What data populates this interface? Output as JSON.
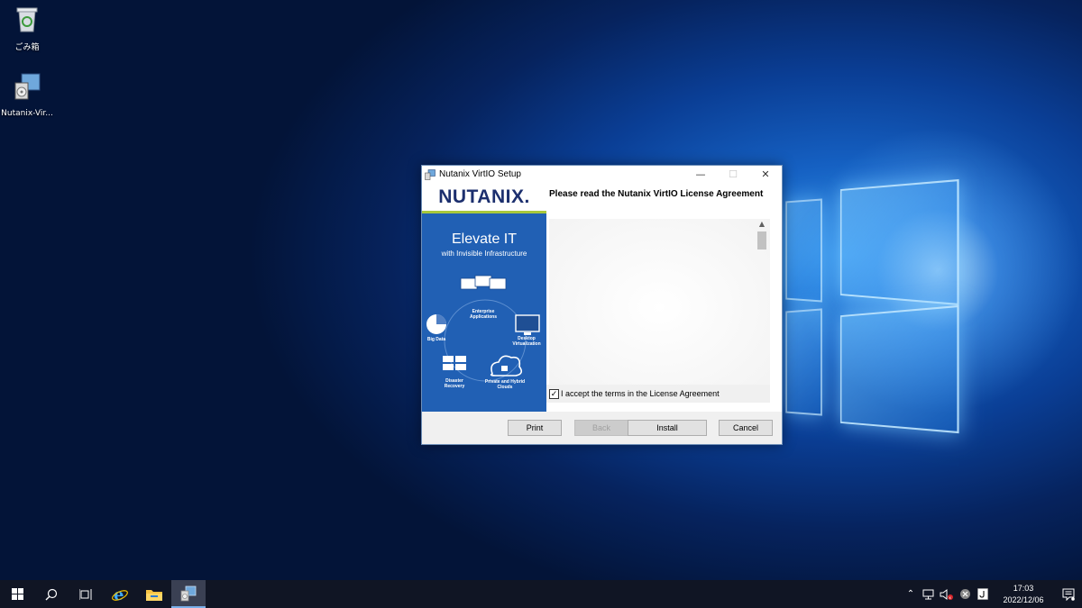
{
  "desktop": {
    "icons": [
      {
        "label": "ごみ箱",
        "icon": "recycle-bin-icon"
      },
      {
        "label": "Nutanix-Vir...",
        "icon": "installer-icon"
      }
    ]
  },
  "dialog": {
    "title": "Nutanix VirtIO Setup",
    "controls": {
      "minimize": "—",
      "maximize": "☐",
      "close": "✕"
    },
    "banner": {
      "logo": "NUTANIX.",
      "headline": "Elevate IT",
      "subhead": "with Invisible Infrastructure",
      "labels": {
        "enterprise": "Enterprise Applications",
        "bigdata": "Big Data",
        "desktop": "Desktop Virtualization",
        "disaster": "Disaster Recovery",
        "cloud": "Private and Hybrid Clouds"
      }
    },
    "heading": "Please read the Nutanix VirtIO License Agreement",
    "license_text": "",
    "accept": {
      "label": "I accept the terms in the License Agreement",
      "checked": true
    },
    "buttons": {
      "print": "Print",
      "back": "Back",
      "install": "Install",
      "cancel": "Cancel"
    },
    "back_enabled": false
  },
  "taskbar": {
    "items": [
      "start-icon",
      "search-icon",
      "task-view-icon",
      "internet-explorer-icon",
      "file-explorer-icon",
      "installer-icon"
    ],
    "active_item": "installer-icon",
    "clock": {
      "time": "17:03",
      "date": "2022/12/06"
    }
  }
}
